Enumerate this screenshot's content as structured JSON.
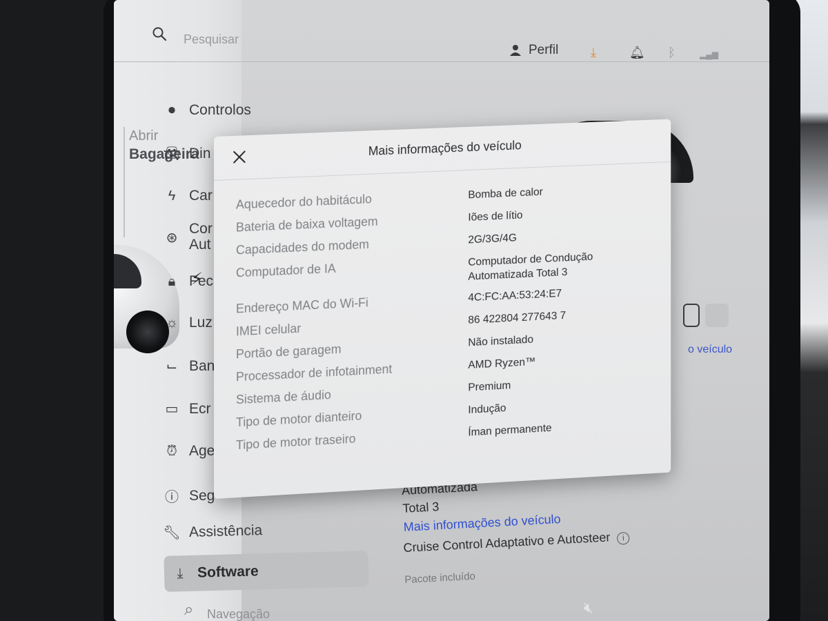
{
  "search": {
    "placeholder": "Pesquisar"
  },
  "header": {
    "profile_label": "Perfil",
    "icons": [
      "profile-icon",
      "download-icon",
      "bell-icon",
      "bluetooth-icon",
      "signal-icon"
    ]
  },
  "car_panel": {
    "trunk_open": "Abrir",
    "trunk_label": "Bagageira"
  },
  "nav": {
    "items": [
      {
        "label": "Controlos",
        "icon": "toggle-icon"
      },
      {
        "label": "Din",
        "icon": "car-icon"
      },
      {
        "label": "Car",
        "icon": "bolt-icon"
      },
      {
        "label": "Cor",
        "label2": "Aut",
        "icon": "steering-wheel-icon"
      },
      {
        "label": "Fec",
        "icon": "lock-icon"
      },
      {
        "label": "Luz",
        "icon": "light-icon"
      },
      {
        "label": "Ban",
        "icon": "seat-icon"
      },
      {
        "label": "Ecr",
        "icon": "screen-icon"
      },
      {
        "label": "Age",
        "icon": "alarm-icon"
      },
      {
        "label": "Seg",
        "icon": "info-icon"
      },
      {
        "label": "Assistência",
        "icon": "wrench-icon"
      },
      {
        "label": "Software",
        "icon": "download-icon"
      },
      {
        "label": "Navegação",
        "icon": "navigation-icon"
      }
    ]
  },
  "modal": {
    "title": "Mais informações do veículo",
    "rows": [
      {
        "label": "Aquecedor do habitáculo",
        "value": "Bomba de calor"
      },
      {
        "label": "Bateria de baixa voltagem",
        "value": "Iões de lítio"
      },
      {
        "label": "Capacidades do modem",
        "value": "2G/3G/4G"
      },
      {
        "label": "Computador de IA",
        "value": "Computador de Condução",
        "value2": "Automatizada Total 3"
      },
      {
        "label": "Endereço MAC do Wi-Fi",
        "value": "4C:FC:AA:53:24:E7"
      },
      {
        "label": "IMEI celular",
        "value": "86 422804 277643 7"
      },
      {
        "label": "Portão de garagem",
        "value": "Não instalado"
      },
      {
        "label": "Processador de infotainment",
        "value": "AMD Ryzen™"
      },
      {
        "label": "Sistema de áudio",
        "value": "Premium"
      },
      {
        "label": "Tipo de motor dianteiro",
        "value": "Indução"
      },
      {
        "label": "Tipo de motor traseiro",
        "value": "Íman permanente"
      }
    ]
  },
  "software_info": {
    "computer_line": "Computador de IA: Computador de Condução Automatizada",
    "computer_line2": "Total 3",
    "more_info_link": "Mais informações do veículo",
    "link_fragment": "o veículo",
    "feature_title": "Cruise Control Adaptativo e Autosteer",
    "feature_sub": "Pacote incluído"
  },
  "colors": {
    "link": "#2f4fd0",
    "accent_orange": "#e08a2c",
    "alert_red": "#d0302a"
  }
}
